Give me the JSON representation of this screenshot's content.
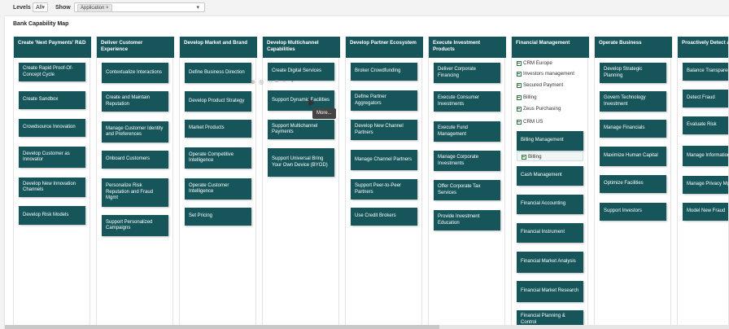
{
  "toolbar": {
    "levels_label": "Levels",
    "levels_value": "All",
    "show_label": "Show",
    "show_chip": "Application",
    "show_chip_close": "×"
  },
  "map": {
    "title": "Bank Capability Map",
    "tooltip": "More..."
  },
  "columns": [
    {
      "title": "Create 'Next Payments' R&D",
      "cards": [
        "Create Rapid Proof-Of-Concept Cycle",
        "Create Sandbox",
        "Crowdsource Innovation",
        "Develop Customer as Innovator",
        "Develop New Innovation Channels",
        "Develop Risk Models"
      ]
    },
    {
      "title": "Deliver Customer Experience",
      "cards": [
        "Contextualize Interactions",
        "Create and Maintain Reputation",
        "Manage Customer Identity and Preferences",
        "Onboard Customers",
        "Personalize Risk Reputation and Fraud Mgmt",
        "Support Personalized Campaigns"
      ]
    },
    {
      "title": "Develop Market and Brand",
      "cards": [
        "Define Business Direction",
        "Develop Product Strategy",
        "Market Products",
        "Operate Competitive Intelligence",
        "Operate Customer Intelligence",
        "Set Pricing"
      ]
    },
    {
      "title": "Develop Multichannel Capabilities",
      "cards": [
        "Create Digital Services",
        "Support Dynamic Facilities",
        "Support Multichannel Payments",
        "Support Universal Bring Your Own Device (BYOD)"
      ]
    },
    {
      "title": "Develop Partner Ecosystem",
      "cards": [
        "Broker Crowdfunding",
        "Define Partner Aggregators",
        "Develop New Channel Partners",
        "Manage Channel Partners",
        "Support Peer-to-Peer Partners",
        "Use Credit Brokers"
      ]
    },
    {
      "title": "Execute Investment Products",
      "cards": [
        "Deliver Corporate Financing",
        "Execute Consumer Investments",
        "Execute Fund Management",
        "Manage Corporate Investments",
        "Offer Corporate Tax Services",
        "Provide Investment Education"
      ]
    },
    {
      "title": "Financial Management",
      "leaves": [
        "CRM Europe",
        "Investors management",
        "Secured Payment",
        "Billing",
        "Zeus Purchasing",
        "CRM US"
      ],
      "cards": [
        "Billing Management",
        "Cash Management",
        "Financial Accounting",
        "Financial Instrument",
        "Financial Market Analysis",
        "Financial Market Research",
        "Financial Planning & Control"
      ],
      "sub_leaf": "Billing"
    },
    {
      "title": "Operate Business",
      "cards": [
        "Develop Strategic Planning",
        "Govern Technology Investment",
        "Manage Financials",
        "Maximize Human Capital",
        "Optimize Facilities",
        "Support Investors"
      ]
    },
    {
      "title": "Proactively Detect and Resolve Risk",
      "cards": [
        "Balance Transparency",
        "Detect Fraud",
        "Evaluate Risk",
        "Manage Information Security",
        "Manage Privacy Mgmt",
        "Model New Fraud"
      ]
    }
  ],
  "colors": {
    "header": "#16565a",
    "card": "#16565a",
    "leaf_icon": "#2f7a3e"
  },
  "icons": {
    "leaf": "application-icon",
    "caret": "chevron-down-icon",
    "close": "close-icon"
  }
}
